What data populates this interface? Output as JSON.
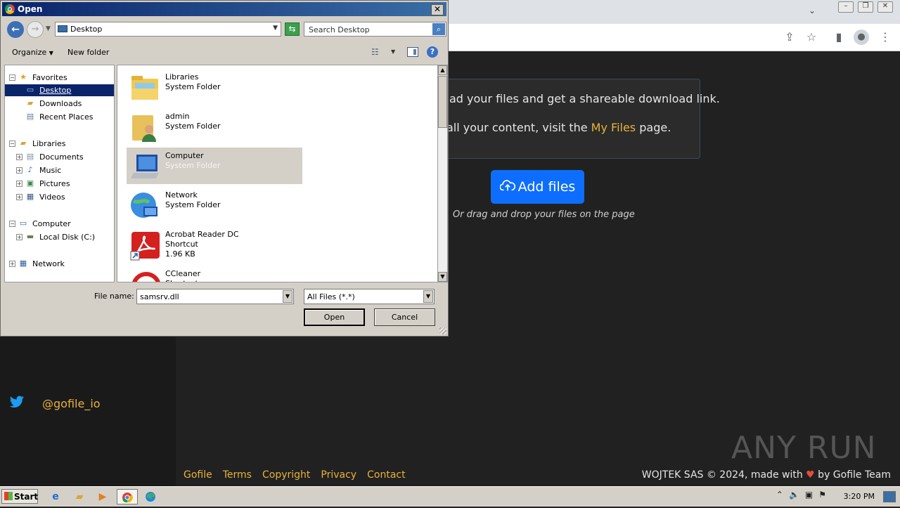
{
  "browser": {
    "tab_menu_icon": "chevron-down-icon",
    "toolbar_icons": [
      "share-icon",
      "star-icon",
      "sidebar-icon",
      "profile-icon",
      "more-icon"
    ]
  },
  "page": {
    "info_line1": "ad your files and get a shareable download link.",
    "info_line2_pre": "all your content, visit the ",
    "info_line2_link": "My Files",
    "info_line2_post": " page.",
    "add_files_label": "Add files",
    "drag_text": "Or drag and drop your files on the page",
    "twitter_handle": "@gofile_io",
    "footer_links": [
      "Gofile",
      "Terms",
      "Copyright",
      "Privacy",
      "Contact"
    ],
    "footer_right_pre": "WOJTEK SAS © 2024, made with ",
    "footer_right_post": " by Gofile Team",
    "watermark": "ANY RUN",
    "colors": {
      "accent": "#e8b23a",
      "button": "#0d6efd",
      "background": "#212121"
    }
  },
  "dialog": {
    "title": "Open",
    "location": "Desktop",
    "search_placeholder": "Search Desktop",
    "organize_label": "Organize",
    "new_folder_label": "New folder",
    "tree": [
      {
        "label": "Favorites",
        "icon": "star-icon",
        "expander": "−",
        "level": 0
      },
      {
        "label": "Desktop",
        "icon": "desktop-icon",
        "expander": "",
        "level": 1,
        "selected": true
      },
      {
        "label": "Downloads",
        "icon": "downloads-icon",
        "expander": "",
        "level": 1
      },
      {
        "label": "Recent Places",
        "icon": "recent-places-icon",
        "expander": "",
        "level": 1
      },
      {
        "label": "Libraries",
        "icon": "libraries-icon",
        "expander": "−",
        "level": 0
      },
      {
        "label": "Documents",
        "icon": "documents-icon",
        "expander": "+",
        "level": 1
      },
      {
        "label": "Music",
        "icon": "music-icon",
        "expander": "+",
        "level": 1
      },
      {
        "label": "Pictures",
        "icon": "pictures-icon",
        "expander": "+",
        "level": 1
      },
      {
        "label": "Videos",
        "icon": "videos-icon",
        "expander": "+",
        "level": 1
      },
      {
        "label": "Computer",
        "icon": "computer-icon",
        "expander": "−",
        "level": 0
      },
      {
        "label": "Local Disk (C:)",
        "icon": "local-disk-icon",
        "expander": "+",
        "level": 1
      },
      {
        "label": "Network",
        "icon": "network-icon",
        "expander": "+",
        "level": 0
      }
    ],
    "files": [
      {
        "name": "Libraries",
        "type": "System Folder",
        "size": "",
        "icon": "libraries-folder-icon"
      },
      {
        "name": "admin",
        "type": "System Folder",
        "size": "",
        "icon": "user-folder-icon"
      },
      {
        "name": "Computer",
        "type": "System Folder",
        "size": "",
        "icon": "computer-icon",
        "selected": true
      },
      {
        "name": "Network",
        "type": "System Folder",
        "size": "",
        "icon": "network-globe-icon"
      },
      {
        "name": "Acrobat Reader DC",
        "type": "Shortcut",
        "size": "1.96 KB",
        "icon": "acrobat-reader-icon"
      },
      {
        "name": "CCleaner",
        "type": "Shortcut",
        "size": "",
        "icon": "ccleaner-icon"
      }
    ],
    "file_name_label": "File name:",
    "file_name_value": "samsrv.dll",
    "file_type_value": "All Files (*.*)",
    "open_label": "Open",
    "cancel_label": "Cancel"
  },
  "taskbar": {
    "start_label": "Start",
    "clock": "3:20 PM",
    "pinned": [
      "ie-icon",
      "explorer-icon",
      "media-player-icon",
      "chrome-icon",
      "edge-icon"
    ]
  }
}
